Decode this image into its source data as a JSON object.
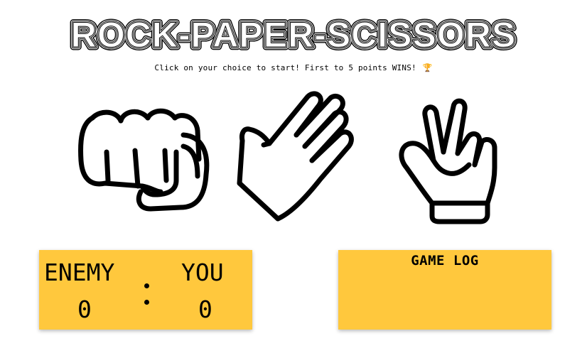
{
  "title": "ROCK-PAPER-SCISSORS",
  "instructions": "Click on your choice to start! First to 5 points WINS!",
  "instructions_icon": "trophy-icon",
  "choices": [
    {
      "name": "rock",
      "icon": "fist-icon"
    },
    {
      "name": "paper",
      "icon": "open-hand-icon"
    },
    {
      "name": "scissors",
      "icon": "two-fingers-hand-icon"
    }
  ],
  "scoreboard": {
    "enemy_label": "ENEMY",
    "you_label": "YOU",
    "enemy_score": "0",
    "you_score": "0"
  },
  "game_log": {
    "title": "GAME LOG",
    "entries": []
  },
  "colors": {
    "panel": "#ffc83d",
    "ink": "#000000",
    "background": "#ffffff"
  }
}
